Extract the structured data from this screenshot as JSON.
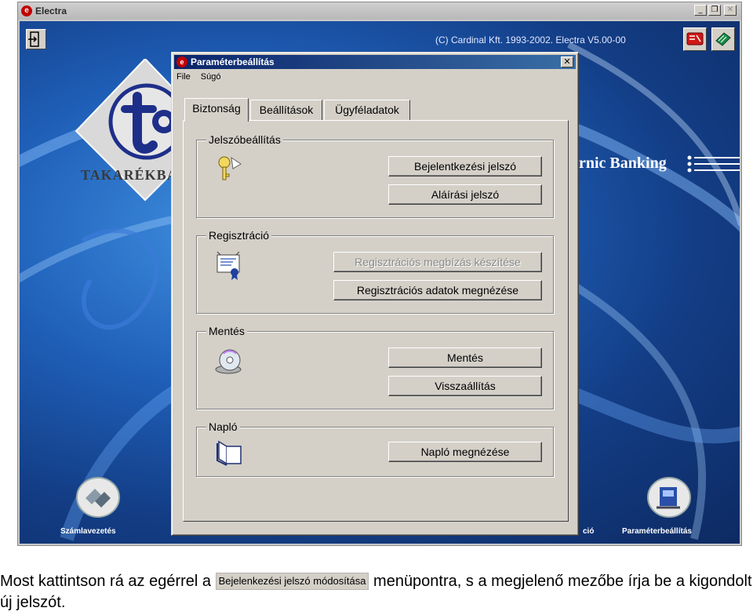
{
  "app": {
    "title": "Electra",
    "copyright": "(C) Cardinal Kft. 1993-2002. Electra V5.00-00",
    "minimize_glyph": "_",
    "maximize_glyph": "❐",
    "close_glyph": "✕",
    "logo_text": "TAKARÉKBAN",
    "banking_text": "rnic Banking",
    "bottom_left_label": "Számlavezetés",
    "bottom_mid_label": "ció",
    "bottom_right_label": "Paraméterbeállítás"
  },
  "dialog": {
    "title": "Paraméterbeállítás",
    "close_glyph": "✕",
    "menu": [
      "File",
      "Súgó"
    ],
    "tabs": [
      "Biztonság",
      "Beállítások",
      "Ügyféladatok"
    ],
    "active_tab": "Biztonság",
    "groups": {
      "password": {
        "label": "Jelszóbeállítás",
        "icon": "keys-icon",
        "buttons": [
          "Bejelentkezési jelszó",
          "Aláírási jelszó"
        ]
      },
      "registration": {
        "label": "Regisztráció",
        "icon": "certificate-icon",
        "buttons": [
          "Regisztrációs megbízás készítése",
          "Regisztrációs adatok megnézése"
        ],
        "disabled_button": "Regisztrációs megbízás készítése"
      },
      "backup": {
        "label": "Mentés",
        "icon": "disk-icon",
        "buttons": [
          "Mentés",
          "Visszaállítás"
        ]
      },
      "log": {
        "label": "Napló",
        "icon": "book-icon",
        "buttons": [
          "Napló megnézése"
        ]
      }
    }
  },
  "caption": {
    "before": "Most kattintson rá az egérrel a",
    "key_label": "Bejelenkezési jelszó módosítása",
    "after": "menüpontra, s a megjelenő mezőbe írja be a kigondolt új jelszót."
  }
}
